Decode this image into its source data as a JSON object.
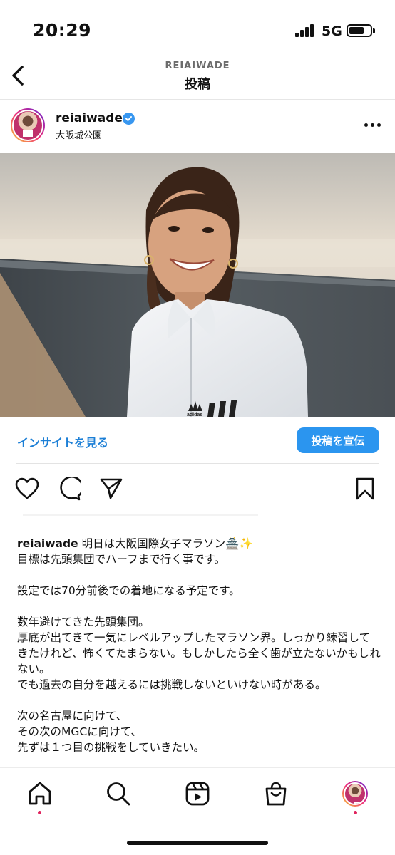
{
  "status_bar": {
    "time": "20:29",
    "network": "5G",
    "icons": [
      "signal-icon",
      "battery-icon"
    ]
  },
  "header": {
    "username": "REIAIWADE",
    "title": "投稿",
    "back_icon": "chevron-left-icon"
  },
  "post": {
    "username": "reiaiwade",
    "verified": true,
    "location": "大阪城公園",
    "more_icon": "more-horizontal-icon",
    "photo_brand_text": "adidas"
  },
  "insights": {
    "link_label": "インサイトを見る",
    "promote_label": "投稿を宣伝",
    "accent_color": "#2b95ef"
  },
  "actions": {
    "icons": [
      "heart-icon",
      "comment-icon",
      "share-icon",
      "bookmark-icon"
    ]
  },
  "caption": {
    "username": "reiaiwade",
    "first_line": "明日は大阪国際女子マラソン🏯✨",
    "lines": [
      "目標は先頭集団でハーフまで行く事です。",
      "",
      "設定では70分前後での着地になる予定です。",
      "",
      "数年避けてきた先頭集団。",
      "厚底が出てきて一気にレベルアップしたマラソン界。しっかり練習してきたけれど、怖くてたまらない。もしかしたら全く歯が立たないかもしれない。",
      "でも過去の自分を越えるには挑戦しないといけない時がある。",
      "",
      "次の名古屋に向けて、",
      "その次のMGCに向けて、",
      "先ずは１つ目の挑戦をしていきたい。"
    ]
  },
  "bottom_nav": {
    "items": [
      "home-icon",
      "search-icon",
      "reels-icon",
      "shop-icon",
      "profile-avatar"
    ],
    "badge_color": "#e0245e"
  }
}
